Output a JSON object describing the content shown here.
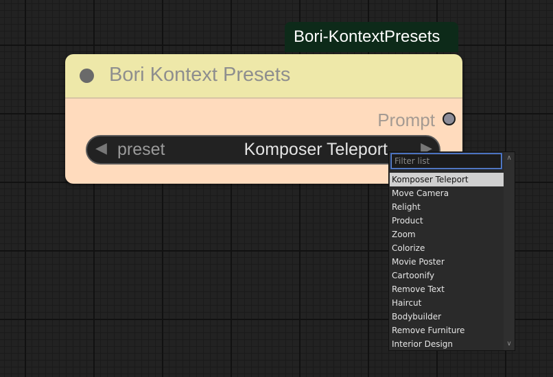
{
  "badge": {
    "label": "Bori-KontextPresets"
  },
  "node": {
    "title": "Bori Kontext Presets",
    "output_label": "Prompt",
    "combo": {
      "name": "preset",
      "value": "Komposer Teleport",
      "left_arrow": "◀",
      "right_arrow": "▶"
    }
  },
  "dropdown": {
    "filter_placeholder": "Filter list",
    "items": [
      "Komposer Teleport",
      "Move Camera",
      "Relight",
      "Product",
      "Zoom",
      "Colorize",
      "Movie Poster",
      "Cartoonify",
      "Remove Text",
      "Haircut",
      "Bodybuilder",
      "Remove Furniture",
      "Interior Design"
    ],
    "selected": "Komposer Teleport"
  },
  "colors": {
    "header": "#eee8a9",
    "body": "#ffdbbd",
    "badge": "#0d2a19",
    "canvas": "#222222",
    "focus": "#2f5fb8"
  }
}
